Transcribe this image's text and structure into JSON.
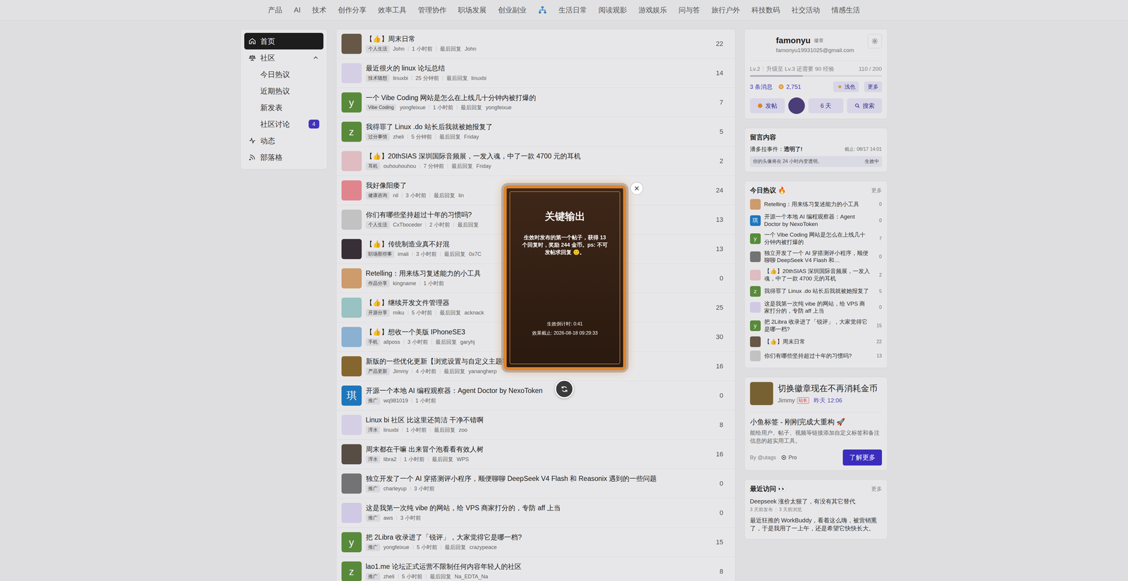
{
  "top_nav": [
    {
      "kind": "text",
      "label": "产品"
    },
    {
      "kind": "text",
      "label": "AI"
    },
    {
      "kind": "text",
      "label": "技术"
    },
    {
      "kind": "text",
      "label": "创作分享"
    },
    {
      "kind": "text",
      "label": "效率工具"
    },
    {
      "kind": "text",
      "label": "管理协作"
    },
    {
      "kind": "text",
      "label": "职场发展"
    },
    {
      "kind": "text",
      "label": "创业副业"
    },
    {
      "kind": "icon"
    },
    {
      "kind": "text",
      "label": "生活日常"
    },
    {
      "kind": "text",
      "label": "阅读观影"
    },
    {
      "kind": "text",
      "label": "游戏娱乐"
    },
    {
      "kind": "text",
      "label": "问与答"
    },
    {
      "kind": "text",
      "label": "旅行户外"
    },
    {
      "kind": "text",
      "label": "科技数码"
    },
    {
      "kind": "text",
      "label": "社交活动"
    },
    {
      "kind": "text",
      "label": "情感生活"
    }
  ],
  "sidebar": {
    "items": [
      {
        "label": "首页",
        "selected": true
      },
      {
        "label": "社区",
        "selected": false,
        "expanded": true,
        "children": [
          {
            "label": "今日热议",
            "selected": false
          },
          {
            "label": "近期热议",
            "selected": false
          },
          {
            "label": "新发表",
            "selected": false
          },
          {
            "label": "社区讨论",
            "selected": false,
            "badge": "4"
          }
        ]
      },
      {
        "label": "动态",
        "selected": false
      },
      {
        "label": "部落格",
        "selected": false
      }
    ]
  },
  "topics": [
    {
      "title": "【👍】周末日常",
      "tag": "个人生活",
      "author": "John",
      "time": "1 小时前",
      "last_label": "最后回复",
      "last_user": "John",
      "count": "22",
      "avatar": {
        "kind": "photo",
        "color": "#6b5a4a"
      }
    },
    {
      "title": "最近很火的 linux 论坛总结",
      "tag": "技术随想",
      "author": "linuxbi",
      "time": "25 分钟前",
      "last_label": "最后回复",
      "last_user": "linuxbi",
      "count": "14",
      "avatar": {
        "kind": "photo",
        "color": "#dcd6ee"
      }
    },
    {
      "title": "一个 Vibe Coding 网站是怎么在上线几十分钟内被打爆的",
      "tag": "Vibe Coding",
      "author": "yongfeixue",
      "time": "1 小时前",
      "last_label": "最后回复",
      "last_user": "yongfeixue",
      "count": "7",
      "avatar": {
        "kind": "letter",
        "letter": "y",
        "color": "#5c8f3d"
      }
    },
    {
      "title": "我得罪了 Linux .do 站长后我就被她报复了",
      "tag": "过分事情",
      "author": "zheli",
      "time": "5 分钟前",
      "last_label": "最后回复",
      "last_user": "Friday",
      "count": "5",
      "avatar": {
        "kind": "letter",
        "letter": "z",
        "color": "#5c8f3d"
      }
    },
    {
      "title": "【👍】20thSIAS 深圳国际音频展，一发入魂，中了一款 4700 元的耳机",
      "tag": "耳机",
      "author": "ouhouhouhou",
      "time": "7 分钟前",
      "last_label": "最后回复",
      "last_user": "Friday",
      "count": "2",
      "avatar": {
        "kind": "photo",
        "color": "#e6c3c8"
      }
    },
    {
      "title": "我好像阳痿了",
      "tag": "健康咨询",
      "author": "nil",
      "time": "3 小时前",
      "last_label": "最后回复",
      "last_user": "lin",
      "count": "24",
      "avatar": {
        "kind": "photo",
        "color": "#e88a93"
      }
    },
    {
      "title": "你们有哪些坚持超过十年的习惯吗?",
      "tag": "个人生活",
      "author": "CxTboceder",
      "time": "2 小时前",
      "last_label": "最后回复",
      "count": "13",
      "avatar": {
        "kind": "photo",
        "color": "#c9c9c9"
      }
    },
    {
      "title": "【👍】传统制造业真不好混",
      "tag": "职场那些事",
      "author": "imali",
      "time": "3 小时前",
      "last_label": "最后回复",
      "last_user": "0x7C",
      "count": "13",
      "avatar": {
        "kind": "photo",
        "color": "#3a3038"
      }
    },
    {
      "title": "Retelling：用来练习复述能力的小工具",
      "tag": "作品分享",
      "author": "kingname",
      "time": "1 小时前",
      "count": "0",
      "avatar": {
        "kind": "photo",
        "color": "#d4a070"
      }
    },
    {
      "title": "【👍】继续开发文件管理器",
      "tag": "开源分享",
      "author": "miku",
      "time": "5 小时前",
      "last_label": "最后回复",
      "last_user": "acknack",
      "count": "25",
      "avatar": {
        "kind": "photo",
        "color": "#9ec9c9"
      }
    },
    {
      "title": "【👍】想收一个美版 IPhoneSE3",
      "tag": "手机",
      "author": "allposs",
      "time": "3 小时前",
      "last_label": "最后回复",
      "last_user": "garyhj",
      "count": "30",
      "avatar": {
        "kind": "photo",
        "color": "#8fb6d9"
      }
    },
    {
      "title": "新版的一些优化更新【浏览设置与自定义主题等】",
      "tag": "产品更新",
      "author": "Jimmy",
      "time": "4 小时前",
      "last_label": "最后回复",
      "last_user": "yanangherp",
      "count": "16",
      "avatar": {
        "kind": "photo",
        "color": "#8a6a30"
      }
    },
    {
      "title": "开源一个本地 AI 编程观察器：Agent Doctor by NexoToken",
      "tag": "推广",
      "author": "wq981019",
      "time": "1 小时前",
      "count": "0",
      "avatar": {
        "kind": "letter",
        "letter": "琪",
        "color": "#1f7ac2"
      }
    },
    {
      "title": "Linux bi 社区 比这里还简洁 干净不错啊",
      "tag": "浑水",
      "author": "linuxbi",
      "time": "1 小时前",
      "last_label": "最后回复",
      "last_user": "zoo",
      "count": "8",
      "avatar": {
        "kind": "photo",
        "color": "#dcd6ee"
      }
    },
    {
      "title": "周末都在干嘛 出来冒个泡看看有效人树",
      "tag": "浑水",
      "author": "libra2",
      "time": "1 小时前",
      "last_label": "最后回复",
      "last_user": "WPS",
      "count": "16",
      "avatar": {
        "kind": "photo",
        "color": "#5a5048"
      }
    },
    {
      "title": "独立开发了一个 AI 穿搭测评小程序，顺便聊聊 DeepSeek V4 Flash 和 Reasonix 遇到的一些问题",
      "tag": "推广",
      "author": "charleyup",
      "time": "3 小时前",
      "count": "0",
      "avatar": {
        "kind": "photo",
        "color": "#777777"
      }
    },
    {
      "title": "这是我第一次纯 vibe 的网站，给 VPS 商家打分的，专防 aff 上当",
      "tag": "推广",
      "author": "aws",
      "time": "3 小时前",
      "count": "0",
      "avatar": {
        "kind": "photo",
        "color": "#d6d0ec"
      }
    },
    {
      "title": "把 2Libra 收录进了「锐评」，大家觉得它是哪一档?",
      "tag": "推广",
      "author": "yongfeixue",
      "time": "5 小时前",
      "last_label": "最后回复",
      "last_user": "crazypeace",
      "count": "15",
      "avatar": {
        "kind": "letter",
        "letter": "y",
        "color": "#5c8f3d"
      }
    },
    {
      "title": "lao1.me 论坛正式运营不限制任何内容年轻人的社区",
      "tag": "推广",
      "author": "zheli",
      "time": "5 小时前",
      "last_label": "最后回复",
      "last_user": "Na_EDTA_Na",
      "count": "8",
      "avatar": {
        "kind": "letter",
        "letter": "z",
        "color": "#5c8f3d"
      }
    }
  ],
  "user": {
    "name": "famonyu",
    "badge": "徽章",
    "email": "famonyu19931025@gmail.com",
    "level": "Lv.2",
    "level_hint": "升级至 Lv.3 还需要 90 经验",
    "exp": "110 / 200",
    "exp_level": 0.4,
    "messages": "3 条消息",
    "coins": "2,751",
    "theme_button": "浅色",
    "more_button": "更多",
    "post_button": "发帖",
    "days": "6 天",
    "search_button": "搜索"
  },
  "notes": {
    "title": "留言内容",
    "items": [
      {
        "name": "潘多拉事件：",
        "value": "透明了!",
        "deadline": "截止: 08/17 14:01",
        "effect": "你的头像将在 24 小时内变透明。",
        "status": "生效中"
      }
    ]
  },
  "hot": {
    "title": "今日热议 🔥",
    "more": "更多",
    "items": [
      {
        "title": "Retelling：用来练习复述能力的小工具",
        "count": "0",
        "avatar": {
          "kind": "photo",
          "color": "#d4a070"
        }
      },
      {
        "title": "开源一个本地 AI 编程观察器：Agent Doctor by NexoToken",
        "count": "0",
        "avatar": {
          "kind": "letter",
          "letter": "琪",
          "color": "#1f7ac2"
        }
      },
      {
        "title": "一个 Vibe Coding 网站是怎么在上线几十分钟内被打爆的",
        "count": "7",
        "avatar": {
          "kind": "letter",
          "letter": "y",
          "color": "#5c8f3d"
        }
      },
      {
        "title": "独立开发了一个 AI 穿搭测评小程序，顺便聊聊 DeepSeek V4 Flash 和…",
        "count": "0",
        "avatar": {
          "kind": "photo",
          "color": "#777777"
        }
      },
      {
        "title": "【👍】20thSIAS 深圳国际音频展，一发入魂，中了一款 4700 元的耳机",
        "count": "2",
        "avatar": {
          "kind": "photo",
          "color": "#e6c3c8"
        }
      },
      {
        "title": "我得罪了 Linux .do 站长后我就被她报复了",
        "count": "5",
        "avatar": {
          "kind": "letter",
          "letter": "z",
          "color": "#5c8f3d"
        }
      },
      {
        "title": "这是我第一次纯 vibe 的网站，给 VPS 商家打分的，专防 aff 上当",
        "count": "0",
        "avatar": {
          "kind": "photo",
          "color": "#d6d0ec"
        }
      },
      {
        "title": "把 2Libra 收录进了「锐评」，大家觉得它是哪一档?",
        "count": "15",
        "avatar": {
          "kind": "letter",
          "letter": "y",
          "color": "#5c8f3d"
        }
      },
      {
        "title": "【👍】周末日常",
        "count": "22",
        "avatar": {
          "kind": "photo",
          "color": "#6b5a4a"
        }
      },
      {
        "title": "你们有哪些坚持超过十年的习惯吗?",
        "count": "13",
        "avatar": {
          "kind": "photo",
          "color": "#c9c9c9"
        }
      }
    ]
  },
  "ad": {
    "title": "切换徽章现在不再消耗金币",
    "author": "Jimmy",
    "role": "站长",
    "time": "昨天 12:06",
    "headline": "小鱼标签 - 刚刚完成大重构 🚀",
    "description": "能给用户、帖子、视频等链接添加自定义标签和备注信息的超实用工具。",
    "by": "By @utags",
    "pro": "Pro",
    "button": "了解更多"
  },
  "recent": {
    "title": "最近访问 👀",
    "more": "更多",
    "items": [
      {
        "title": "Deepseek 涨价太狠了，有没有其它替代",
        "published": "3 天前发布",
        "viewed": "3 天前浏览"
      },
      {
        "title": "最近狂推的 WorkBuddy，看着这么嗨，被营销熏了，于是我用了一上午，还是希望它快快长大。"
      }
    ]
  },
  "modal": {
    "title": "关键输出",
    "body": "生效时发布的第一个帖子，获得 13 个回复时，奖励 244 金币。ps: 不可发帖求回复 🙂。",
    "countdown": "生效倒计时: 0:41",
    "deadline": "效果截止: 2026-08-18 09:29:33",
    "close": "×"
  }
}
